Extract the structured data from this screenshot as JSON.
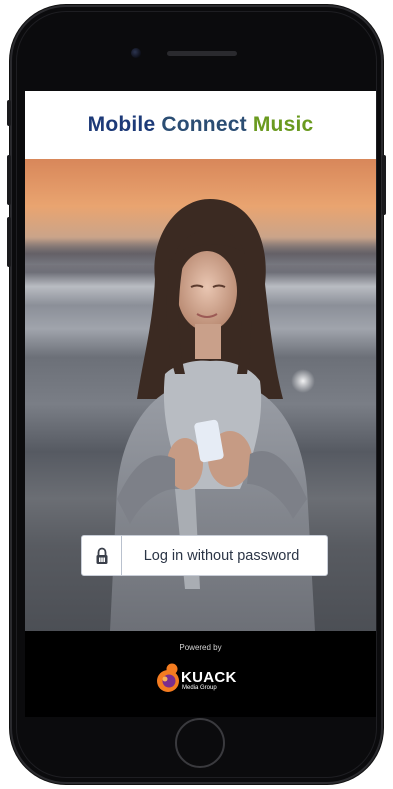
{
  "app": {
    "title_part1": "Mobile",
    "title_part2": "Connect",
    "title_part3": "Music"
  },
  "login": {
    "label": "Log in without password",
    "icon": "lock-icon"
  },
  "footer": {
    "powered_by": "Powered by",
    "brand_name": "KUACK",
    "brand_subtitle": "Media Group",
    "logo_icon": "kuack-logo-icon"
  },
  "device": {
    "home_button_icon": "home-button"
  },
  "colors": {
    "title_blue": "#1d3a78",
    "title_green": "#6a9a1f",
    "logo_orange": "#f47c20",
    "logo_purple": "#7b2e8e"
  }
}
